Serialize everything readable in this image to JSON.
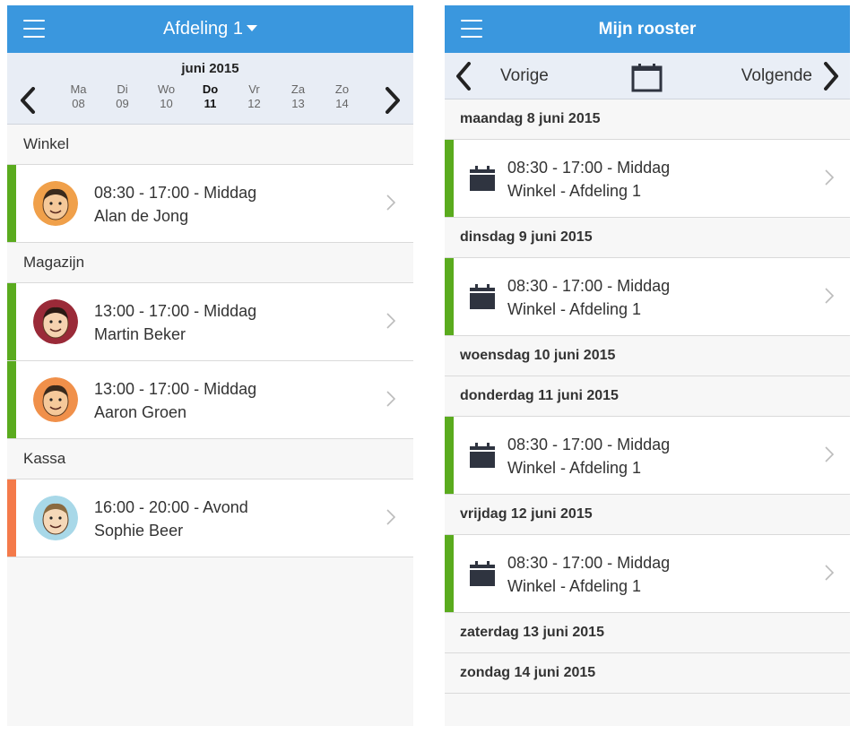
{
  "left": {
    "title": "Afdeling 1",
    "month": "juni 2015",
    "days": [
      {
        "name": "Ma",
        "num": "08"
      },
      {
        "name": "Di",
        "num": "09"
      },
      {
        "name": "Wo",
        "num": "10"
      },
      {
        "name": "Do",
        "num": "11"
      },
      {
        "name": "Vr",
        "num": "12"
      },
      {
        "name": "Za",
        "num": "13"
      },
      {
        "name": "Zo",
        "num": "14"
      }
    ],
    "sections": [
      {
        "name": "Winkel",
        "shifts": [
          {
            "time": "08:30 - 17:00 - Middag",
            "person": "Alan de Jong",
            "color": "#5aab1e"
          }
        ]
      },
      {
        "name": "Magazijn",
        "shifts": [
          {
            "time": "13:00 - 17:00 - Middag",
            "person": "Martin Beker",
            "color": "#5aab1e"
          },
          {
            "time": "13:00 - 17:00 - Middag",
            "person": "Aaron Groen",
            "color": "#5aab1e"
          }
        ]
      },
      {
        "name": "Kassa",
        "shifts": [
          {
            "time": "16:00 - 20:00 - Avond",
            "person": "Sophie Beer",
            "color": "#f47a4a"
          }
        ]
      }
    ]
  },
  "right": {
    "title": "Mijn rooster",
    "prev_label": "Vorige",
    "next_label": "Volgende",
    "days": [
      {
        "label": "maandag 8 juni 2015",
        "shift": {
          "time": "08:30 - 17:00 - Middag",
          "place": "Winkel - Afdeling 1"
        }
      },
      {
        "label": "dinsdag 9 juni 2015",
        "shift": {
          "time": "08:30 - 17:00 - Middag",
          "place": "Winkel - Afdeling 1"
        }
      },
      {
        "label": "woensdag 10 juni 2015"
      },
      {
        "label": "donderdag 11 juni 2015",
        "shift": {
          "time": "08:30 - 17:00 - Middag",
          "place": "Winkel - Afdeling 1"
        }
      },
      {
        "label": "vrijdag 12 juni 2015",
        "shift": {
          "time": "08:30 - 17:00 - Middag",
          "place": "Winkel - Afdeling 1"
        }
      },
      {
        "label": "zaterdag 13 juni 2015"
      },
      {
        "label": "zondag 14 juni 2015"
      }
    ]
  },
  "colors": {
    "navbar": "#3a97de",
    "green": "#5aab1e",
    "orange": "#f47a4a",
    "calendar_icon": "#2f3440"
  }
}
